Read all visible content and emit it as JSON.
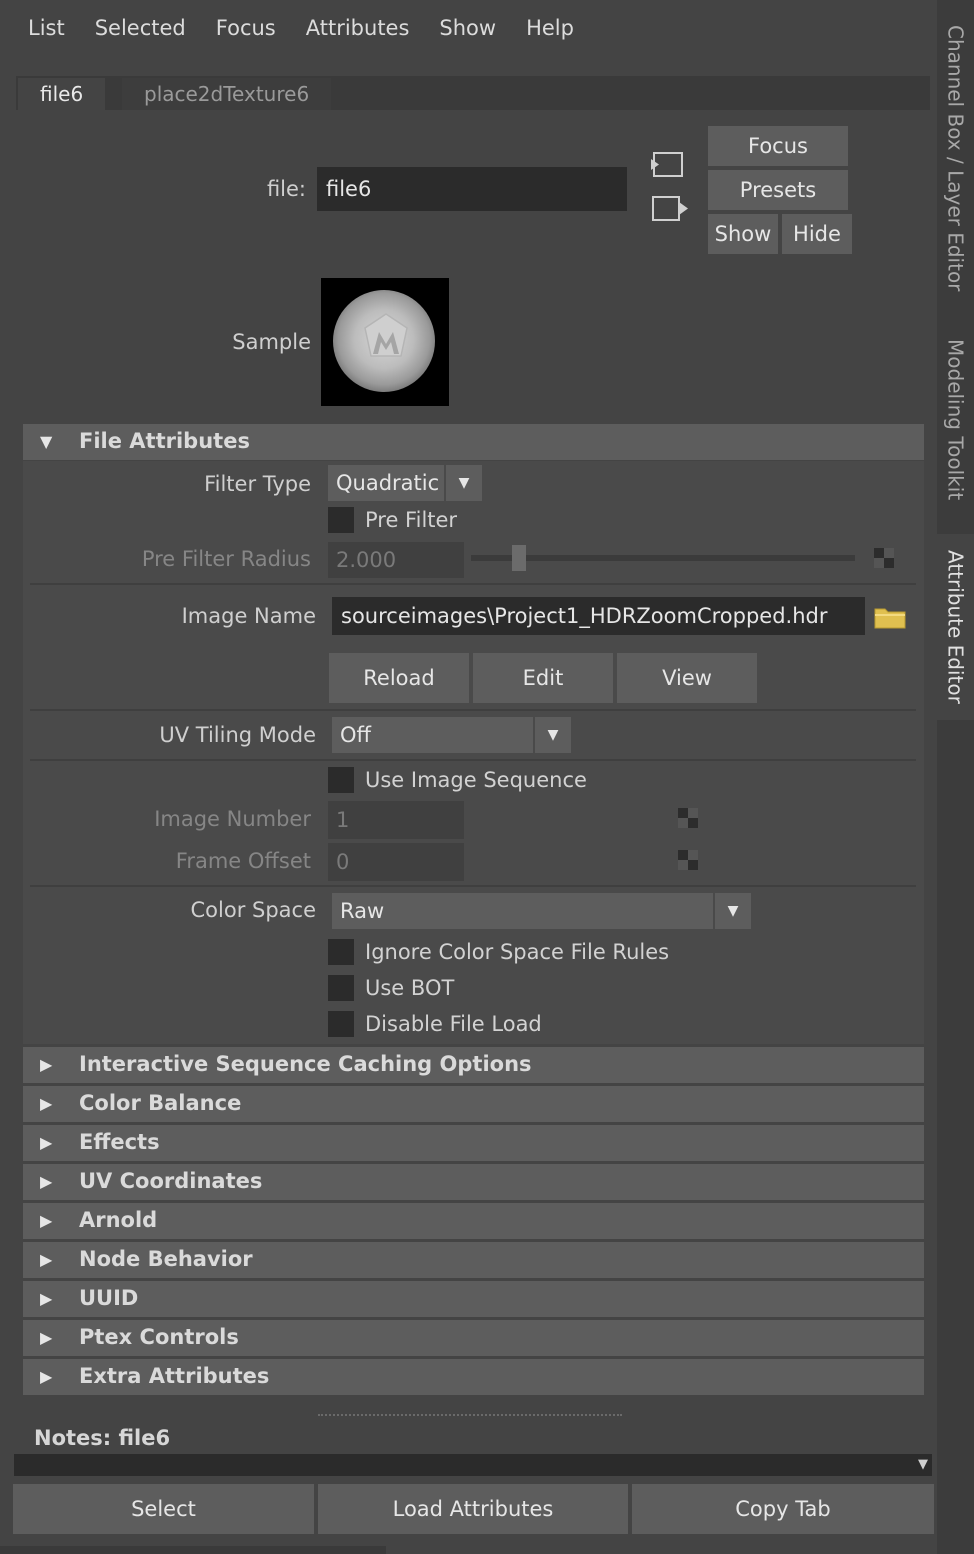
{
  "menu": [
    "List",
    "Selected",
    "Focus",
    "Attributes",
    "Show",
    "Help"
  ],
  "tabs": {
    "active": "file6",
    "inactive": "place2dTexture6"
  },
  "header": {
    "file_label": "file:",
    "file_value": "file6",
    "focus_button": "Focus",
    "presets_button": "Presets",
    "show_button": "Show",
    "hide_button": "Hide",
    "sample_label": "Sample"
  },
  "file_attributes": {
    "title": "File Attributes",
    "filter_type_label": "Filter Type",
    "filter_type_value": "Quadratic",
    "pre_filter_label": "Pre Filter",
    "pre_filter_radius_label": "Pre Filter Radius",
    "pre_filter_radius_value": "2.000",
    "image_name_label": "Image Name",
    "image_name_value": "sourceimages\\Project1_HDRZoomCropped.hdr",
    "reload_button": "Reload",
    "edit_button": "Edit",
    "view_button": "View",
    "uv_tiling_label": "UV Tiling Mode",
    "uv_tiling_value": "Off",
    "use_image_sequence_label": "Use Image Sequence",
    "image_number_label": "Image Number",
    "image_number_value": "1",
    "frame_offset_label": "Frame Offset",
    "frame_offset_value": "0",
    "color_space_label": "Color Space",
    "color_space_value": "Raw",
    "ignore_cs_label": "Ignore Color Space File Rules",
    "use_bot_label": "Use BOT",
    "disable_file_load_label": "Disable File Load"
  },
  "collapsed_sections": [
    "Interactive Sequence Caching Options",
    "Color Balance",
    "Effects",
    "UV Coordinates",
    "Arnold",
    "Node Behavior",
    "UUID",
    "Ptex Controls",
    "Extra Attributes"
  ],
  "notes": {
    "label": "Notes:  file6"
  },
  "bottom_buttons": {
    "select": "Select",
    "load": "Load Attributes",
    "copy": "Copy Tab"
  },
  "side_tabs": {
    "channel_box": "Channel Box / Layer Editor",
    "modeling": "Modeling Toolkit",
    "attribute": "Attribute Editor"
  },
  "colors": {
    "panel_bg": "#444444",
    "section_bg": "#5d5d5d",
    "field_bg": "#2b2b2b",
    "folder": "#e0c050"
  }
}
